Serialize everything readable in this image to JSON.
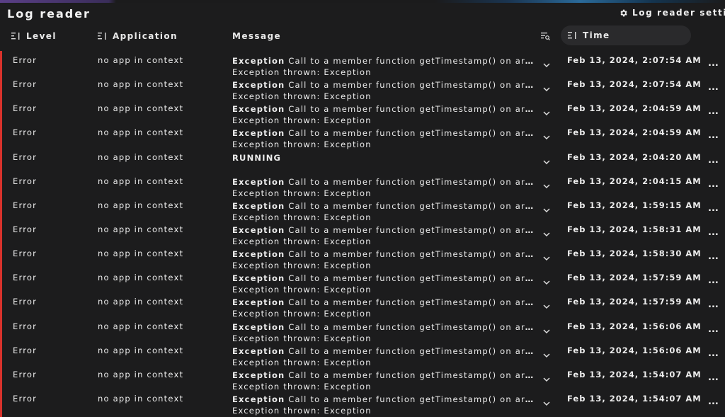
{
  "app": {
    "title": "Log reader",
    "settings_label": "Log reader settings"
  },
  "columns": {
    "level": "Level",
    "application": "Application",
    "message": "Message",
    "time": "Time"
  },
  "icons": {
    "settings": "gear-icon",
    "sort": "sort-icon",
    "filter": "filter-search-icon",
    "expand": "chevron-down-icon",
    "more": "more-dots-icon"
  },
  "colors": {
    "error_accent": "#d8322c",
    "background": "#1c1c1d",
    "time_header_bg": "#2a2a2c"
  },
  "more_label": "...",
  "rows": [
    {
      "level": "Error",
      "application": "no app in context",
      "msg_bold": "Exception",
      "msg_rest": " Call to a member function getTimestamp() on array",
      "msg_line2": "Exception thrown: Exception",
      "time": "Feb 13, 2024, 2:07:54 AM"
    },
    {
      "level": "Error",
      "application": "no app in context",
      "msg_bold": "Exception",
      "msg_rest": " Call to a member function getTimestamp() on array",
      "msg_line2": "Exception thrown: Exception",
      "time": "Feb 13, 2024, 2:07:54 AM"
    },
    {
      "level": "Error",
      "application": "no app in context",
      "msg_bold": "Exception",
      "msg_rest": " Call to a member function getTimestamp() on array",
      "msg_line2": "Exception thrown: Exception",
      "time": "Feb 13, 2024, 2:04:59 AM"
    },
    {
      "level": "Error",
      "application": "no app in context",
      "msg_bold": "Exception",
      "msg_rest": " Call to a member function getTimestamp() on array",
      "msg_line2": "Exception thrown: Exception",
      "time": "Feb 13, 2024, 2:04:59 AM"
    },
    {
      "level": "Error",
      "application": "no app in context",
      "msg_bold": "RUNNING",
      "msg_rest": "",
      "msg_line2": "",
      "time": "Feb 13, 2024, 2:04:20 AM"
    },
    {
      "level": "Error",
      "application": "no app in context",
      "msg_bold": "Exception",
      "msg_rest": " Call to a member function getTimestamp() on array",
      "msg_line2": "Exception thrown: Exception",
      "time": "Feb 13, 2024, 2:04:15 AM"
    },
    {
      "level": "Error",
      "application": "no app in context",
      "msg_bold": "Exception",
      "msg_rest": " Call to a member function getTimestamp() on array",
      "msg_line2": "Exception thrown: Exception",
      "time": "Feb 13, 2024, 1:59:15 AM"
    },
    {
      "level": "Error",
      "application": "no app in context",
      "msg_bold": "Exception",
      "msg_rest": " Call to a member function getTimestamp() on array",
      "msg_line2": "Exception thrown: Exception",
      "time": "Feb 13, 2024, 1:58:31 AM"
    },
    {
      "level": "Error",
      "application": "no app in context",
      "msg_bold": "Exception",
      "msg_rest": " Call to a member function getTimestamp() on array",
      "msg_line2": "Exception thrown: Exception",
      "time": "Feb 13, 2024, 1:58:30 AM"
    },
    {
      "level": "Error",
      "application": "no app in context",
      "msg_bold": "Exception",
      "msg_rest": " Call to a member function getTimestamp() on array",
      "msg_line2": "Exception thrown: Exception",
      "time": "Feb 13, 2024, 1:57:59 AM"
    },
    {
      "level": "Error",
      "application": "no app in context",
      "msg_bold": "Exception",
      "msg_rest": " Call to a member function getTimestamp() on array",
      "msg_line2": "Exception thrown: Exception",
      "time": "Feb 13, 2024, 1:57:59 AM"
    },
    {
      "level": "Error",
      "application": "no app in context",
      "msg_bold": "Exception",
      "msg_rest": " Call to a member function getTimestamp() on array",
      "msg_line2": "Exception thrown: Exception",
      "time": "Feb 13, 2024, 1:56:06 AM"
    },
    {
      "level": "Error",
      "application": "no app in context",
      "msg_bold": "Exception",
      "msg_rest": " Call to a member function getTimestamp() on array",
      "msg_line2": "Exception thrown: Exception",
      "time": "Feb 13, 2024, 1:56:06 AM"
    },
    {
      "level": "Error",
      "application": "no app in context",
      "msg_bold": "Exception",
      "msg_rest": " Call to a member function getTimestamp() on array",
      "msg_line2": "Exception thrown: Exception",
      "time": "Feb 13, 2024, 1:54:07 AM"
    },
    {
      "level": "Error",
      "application": "no app in context",
      "msg_bold": "Exception",
      "msg_rest": " Call to a member function getTimestamp() on array",
      "msg_line2": "Exception thrown: Exception",
      "time": "Feb 13, 2024, 1:54:07 AM"
    }
  ]
}
